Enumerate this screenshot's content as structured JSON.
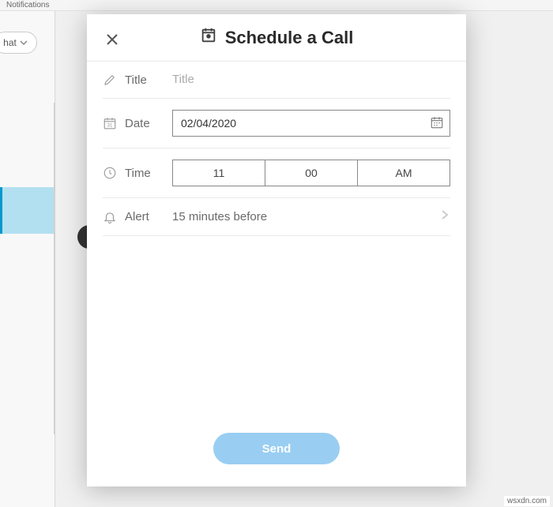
{
  "background": {
    "topbar": "Notifications",
    "chatFilter": "hat"
  },
  "modal": {
    "title": "Schedule a Call",
    "closeLabel": "Close",
    "fields": {
      "title": {
        "label": "Title",
        "placeholder": "Title",
        "value": ""
      },
      "date": {
        "label": "Date",
        "value": "02/04/2020"
      },
      "time": {
        "label": "Time",
        "hour": "11",
        "minute": "00",
        "period": "AM"
      },
      "alert": {
        "label": "Alert",
        "value": "15 minutes before"
      }
    },
    "sendLabel": "Send"
  },
  "watermark": "wsxdn.com"
}
